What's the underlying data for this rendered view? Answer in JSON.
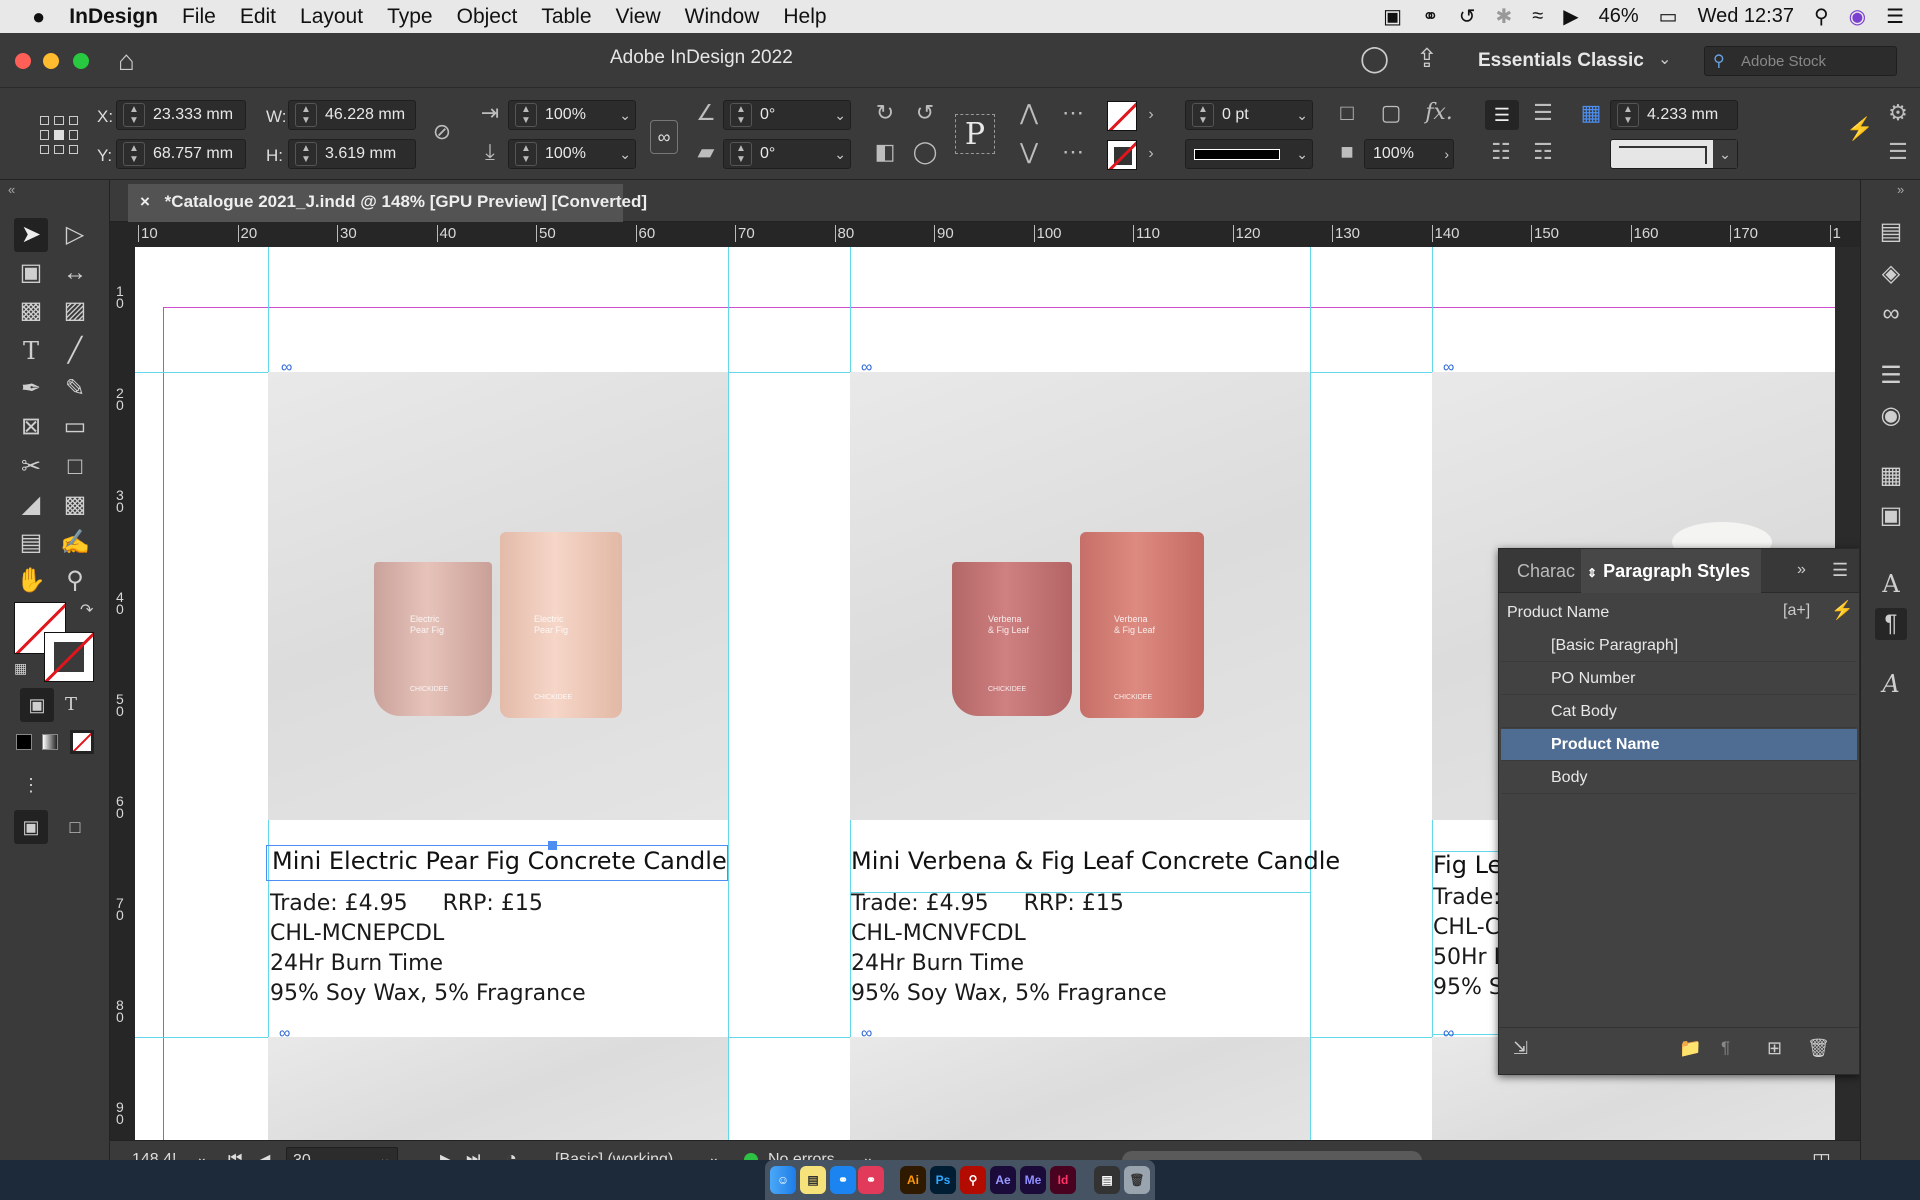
{
  "menubar": {
    "apple": "",
    "app": "InDesign",
    "items": [
      "File",
      "Edit",
      "Layout",
      "Type",
      "Object",
      "Table",
      "View",
      "Window",
      "Help"
    ],
    "battery": "46%",
    "clock": "Wed 12:37"
  },
  "titlebar": {
    "title": "Adobe InDesign 2022",
    "workspace": "Essentials Classic",
    "stock_placeholder": "Adobe Stock"
  },
  "control": {
    "x_label": "X:",
    "y_label": "Y:",
    "w_label": "W:",
    "h_label": "H:",
    "x": "23.333 mm",
    "y": "68.757 mm",
    "w": "46.228 mm",
    "h": "3.619 mm",
    "scale_x": "100%",
    "scale_y": "100%",
    "rotate": "0°",
    "shear": "0°",
    "stroke_weight": "0 pt",
    "opacity": "100%",
    "gap": "4.233 mm",
    "p_icon": "P",
    "fx": "fx."
  },
  "doc_tab": {
    "close": "×",
    "title": "*Catalogue 2021_J.indd @ 148% [GPU Preview] [Converted]"
  },
  "ruler": {
    "h": [
      "10",
      "20",
      "30",
      "40",
      "50",
      "60",
      "70",
      "80",
      "90",
      "100",
      "110",
      "120",
      "130",
      "140",
      "150",
      "160",
      "170",
      "1"
    ],
    "v": [
      "1\n0",
      "2\n0",
      "3\n0",
      "4\n0",
      "5\n0",
      "6\n0",
      "7\n0",
      "8\n0",
      "9\n0"
    ]
  },
  "products": [
    {
      "name": "Mini Electric Pear Fig Concrete Candle",
      "trade": "Trade: £4.95",
      "rrp": "RRP: £15",
      "code": "CHL-MCNEPCDL",
      "burn": "24Hr Burn Time",
      "wax": "95% Soy Wax, 5% Fragrance",
      "label_small": "Electric\nPear Fig",
      "label_big": "Electric\nPear Fig",
      "brand": "CHICKIDEE",
      "color_small": "#e0b8b0",
      "color_big": "#f0cdbf"
    },
    {
      "name": "Mini Verbena & Fig Leaf Concrete Candle",
      "trade": "Trade: £4.95",
      "rrp": "RRP: £15",
      "code": "CHL-MCNVFCDL",
      "burn": "24Hr Burn Time",
      "wax": "95% Soy Wax, 5% Fragrance",
      "label_small": "Verbena\n& Fig Leaf",
      "label_big": "Verbena\n& Fig Leaf",
      "brand": "CHICKIDEE",
      "color_small": "#c97a7a",
      "color_big": "#d9817a"
    },
    {
      "name": "Fig Le",
      "trade": "Trade:",
      "code": "CHL-C",
      "burn": "50Hr I",
      "wax": "95% S"
    }
  ],
  "panel": {
    "tab_char": "Charac",
    "tab_para": "Paragraph Styles",
    "current": "Product Name",
    "new_btn": "[a+]",
    "styles": [
      "[Basic Paragraph]",
      "PO Number",
      "Cat Body",
      "Product Name",
      "Body"
    ],
    "selected_index": 3
  },
  "status": {
    "zoom": "148.4!",
    "page": "30",
    "style": "[Basic] (working)",
    "errors": "No errors"
  },
  "dock_apps": [
    "Ai",
    "Ps",
    "Ae",
    "Me",
    "Id"
  ]
}
